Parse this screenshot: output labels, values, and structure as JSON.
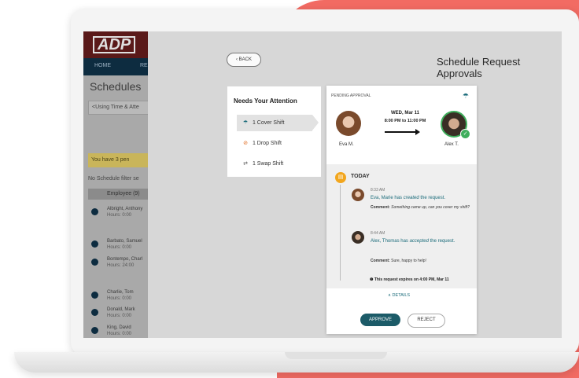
{
  "background_app": {
    "logo": "ADP",
    "nav": [
      "HOME",
      "RE"
    ],
    "title": "Schedules",
    "select_value": "<Using Time & Atte",
    "warning": "You have 3 pen",
    "filter_text": "No Schedule filter se",
    "table_header": "Employee (9)",
    "rows": [
      {
        "name": "Albright, Anthony",
        "hours": "Hours: 0:00"
      },
      {
        "name": "Barbato, Samuel",
        "hours": "Hours: 0:00"
      },
      {
        "name": "Bontempo, Charl",
        "hours": "Hours: 24:00"
      },
      {
        "name": "Charlie, Tom",
        "hours": "Hours: 0:00"
      },
      {
        "name": "Donald, Mark",
        "hours": "Hours: 0:00"
      },
      {
        "name": "King, David",
        "hours": "Hours: 0:00"
      }
    ]
  },
  "header": {
    "back_label": "‹ BACK",
    "title": "Schedule Request Approvals"
  },
  "attention": {
    "title": "Needs Your Attention",
    "items": [
      {
        "label": "1 Cover Shift",
        "icon": "umbrella-icon"
      },
      {
        "label": "1 Drop Shift",
        "icon": "drop-icon"
      },
      {
        "label": "1 Swap Shift",
        "icon": "swap-icon"
      }
    ]
  },
  "request": {
    "status": "PENDING APPROVAL",
    "date": "WED, Mar 11",
    "time": "8:00 PM to 11:00 PM",
    "from_name": "Eva M.",
    "to_name": "Alex T."
  },
  "timeline": {
    "heading": "TODAY",
    "events": [
      {
        "time": "8:33 AM",
        "actor": "Eva, Marie",
        "verb": "created",
        "text_before": " has ",
        "text_after": " the request.",
        "comment_label": "Comment:",
        "comment": "Something came up, can you cover my shift?"
      },
      {
        "time": "8:44 AM",
        "actor": "Alex, Thomas",
        "verb": "accepted",
        "text_before": " has ",
        "text_after": " the request.",
        "comment_label": "Comment:",
        "comment": "Sure, happy to help!"
      }
    ],
    "expires": "This request expires on 4:00 PM, Mar 11"
  },
  "actions": {
    "details": "∧ DETAILS",
    "approve": "APPROVE",
    "reject": "REJECT"
  },
  "colors": {
    "coral": "#f26b63",
    "teal": "#1c5b68",
    "green_check": "#3fae5c",
    "orange": "#f2a61d"
  }
}
